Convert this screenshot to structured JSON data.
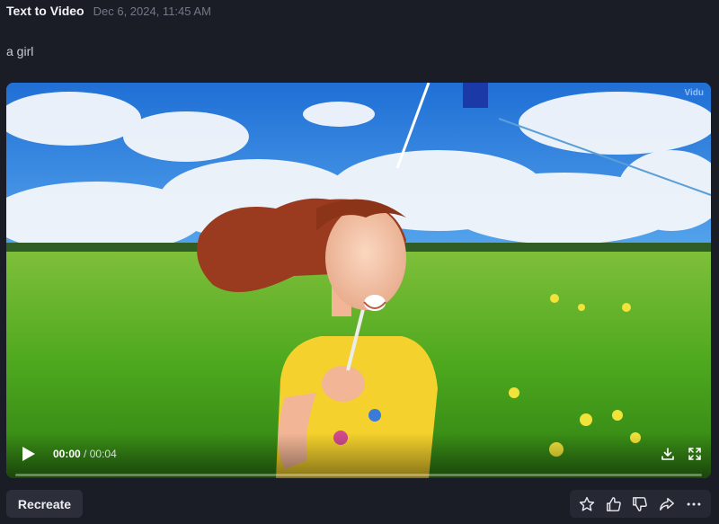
{
  "header": {
    "title": "Text to Video",
    "timestamp": "Dec 6, 2024, 11:45 AM"
  },
  "prompt": "a girl",
  "video": {
    "watermark": "Vidu",
    "current_time": "00:00",
    "separator": " / ",
    "duration": "00:04",
    "progress": 0,
    "icons": {
      "play": "play-icon",
      "download": "download-icon",
      "fullscreen": "fullscreen-icon"
    }
  },
  "actions": {
    "recreate_label": "Recreate",
    "icons": [
      "star-icon",
      "thumbs-up-icon",
      "thumbs-down-icon",
      "share-icon",
      "more-icon"
    ]
  },
  "colors": {
    "background": "#1b1d26",
    "panel": "#2c2f3a",
    "action_bar": "#262934",
    "text_muted": "#747888"
  }
}
